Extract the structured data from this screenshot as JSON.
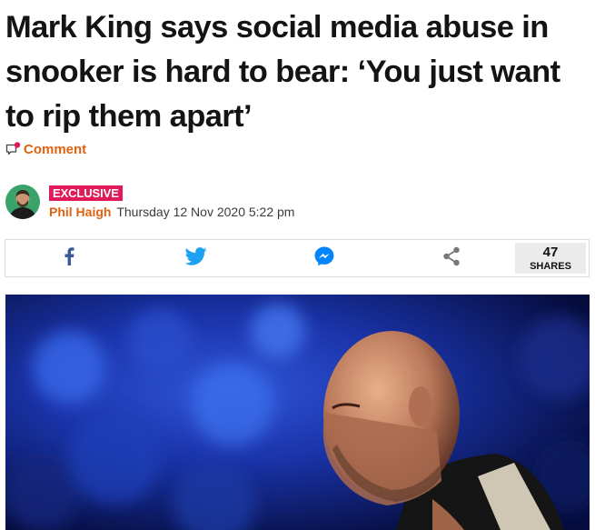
{
  "article": {
    "headline": "Mark King says social media abuse in snooker is hard to bear: ‘You just want to rip them apart’",
    "comment_label": "Comment",
    "badge": "EXCLUSIVE",
    "author": "Phil Haigh",
    "timestamp": "Thursday 12 Nov 2020 5:22 pm"
  },
  "share": {
    "buttons": [
      "facebook-icon",
      "twitter-icon",
      "messenger-icon",
      "share-icon"
    ],
    "count": "47",
    "count_label": "SHARES"
  },
  "colors": {
    "accent": "#e0610f",
    "badge": "#e21a5a",
    "facebook": "#3b5998",
    "twitter": "#1da1f2",
    "messenger": "#0084ff"
  }
}
